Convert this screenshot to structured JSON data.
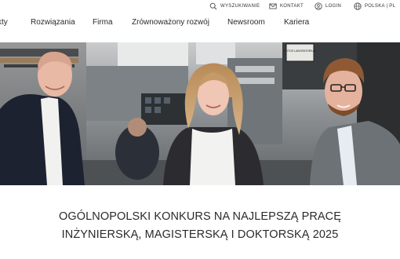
{
  "utility_bar": {
    "search_label": "WYSZUKIWANIE",
    "contact_label": "KONTAKT",
    "login_label": "LOGIN",
    "language_label": "POLSKA | PL"
  },
  "main_nav": {
    "items": [
      {
        "label": "kty"
      },
      {
        "label": "Rozwiązania"
      },
      {
        "label": "Firma"
      },
      {
        "label": "Zrównoważony rozwój"
      },
      {
        "label": "Newsroom"
      },
      {
        "label": "Kariera"
      }
    ]
  },
  "hero": {
    "sign_text": "FOTOS LABORATORIUM"
  },
  "headline": {
    "line1": "OGÓLNOPOLSKI KONKURS NA NAJLEPSZĄ PRACĘ",
    "line2": "INŻYNIERSKĄ, MAGISTERSKĄ I DOKTORSKĄ 2025"
  },
  "colors": {
    "text": "#2a2a2a",
    "icon": "#555555"
  }
}
